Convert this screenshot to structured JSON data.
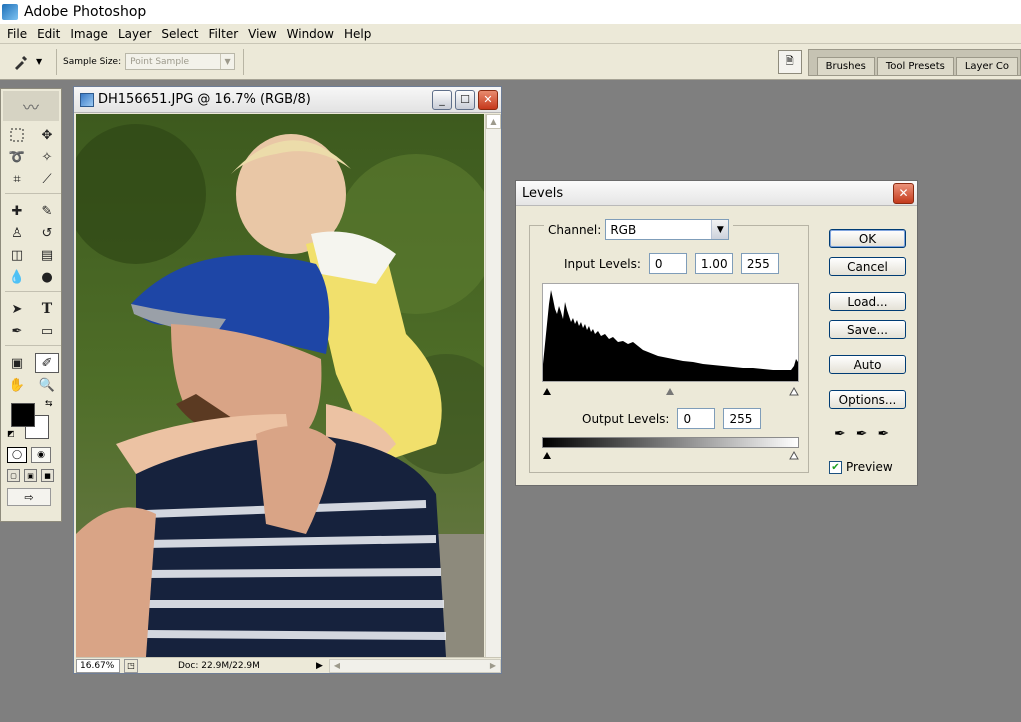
{
  "app": {
    "title": "Adobe Photoshop"
  },
  "menu": [
    "File",
    "Edit",
    "Image",
    "Layer",
    "Select",
    "Filter",
    "View",
    "Window",
    "Help"
  ],
  "options_bar": {
    "sample_size_label": "Sample Size:",
    "sample_size_value": "Point Sample",
    "palette_tabs": [
      "Brushes",
      "Tool Presets",
      "Layer Co"
    ]
  },
  "document": {
    "title": "DH156651.JPG @ 16.7% (RGB/8)",
    "zoom": "16.67%",
    "doc_info": "Doc: 22.9M/22.9M"
  },
  "levels": {
    "title": "Levels",
    "channel_label": "Channel:",
    "channel_value": "RGB",
    "input_levels_label": "Input Levels:",
    "input_black": "0",
    "input_gamma": "1.00",
    "input_white": "255",
    "output_levels_label": "Output Levels:",
    "output_black": "0",
    "output_white": "255",
    "buttons": {
      "ok": "OK",
      "cancel": "Cancel",
      "load": "Load...",
      "save": "Save...",
      "auto": "Auto",
      "options": "Options..."
    },
    "preview_label": "Preview",
    "preview_checked": true
  },
  "colors": {
    "foreground": "#000000",
    "background": "#ffffff",
    "workspace": "#7f7f7f",
    "dialog_bg": "#ece9d8",
    "close_red": "#c6391c"
  },
  "icons": {
    "toolbox": [
      "marquee",
      "move",
      "lasso",
      "magic-wand",
      "crop",
      "slice",
      "healing",
      "brush",
      "clone-stamp",
      "history-brush",
      "eraser",
      "gradient",
      "blur",
      "dodge",
      "path-select",
      "type",
      "pen",
      "shape",
      "notes",
      "eyedropper",
      "hand",
      "zoom"
    ]
  }
}
